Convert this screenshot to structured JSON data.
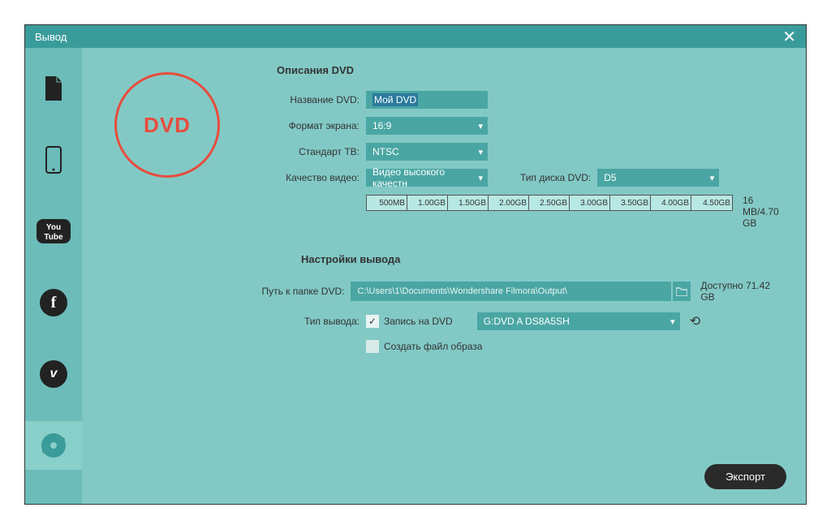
{
  "window": {
    "title": "Вывод"
  },
  "dvd_badge": "DVD",
  "sections": {
    "desc_title": "Описания DVD",
    "output_title": "Настройки вывода"
  },
  "labels": {
    "dvd_name": "Название DVD:",
    "aspect": "Формат экрана:",
    "tv_std": "Стандарт ТВ:",
    "quality": "Качество видео:",
    "disc_type": "Тип диска DVD:",
    "path": "Путь к папке DVD:",
    "out_type": "Тип вывода:",
    "burn": "Запись на DVD",
    "create_iso": "Создать файл образа",
    "available_prefix": "Доступно "
  },
  "values": {
    "dvd_name": "Мой DVD",
    "aspect": "16:9",
    "tv_std": "NTSC",
    "quality": "Видео высокого качестн",
    "disc_type": "D5",
    "path": "C:\\Users\\1\\Documents\\Wondershare Filmora\\Output\\",
    "drive": "G:DVD A DS8A5SH",
    "available": "71.42 GB",
    "size_info": "16 MB/4.70 GB"
  },
  "ruler": [
    "500MB",
    "1.00GB",
    "1.50GB",
    "2.00GB",
    "2.50GB",
    "3.00GB",
    "3.50GB",
    "4.00GB",
    "4.50GB"
  ],
  "export_btn": "Экспорт"
}
